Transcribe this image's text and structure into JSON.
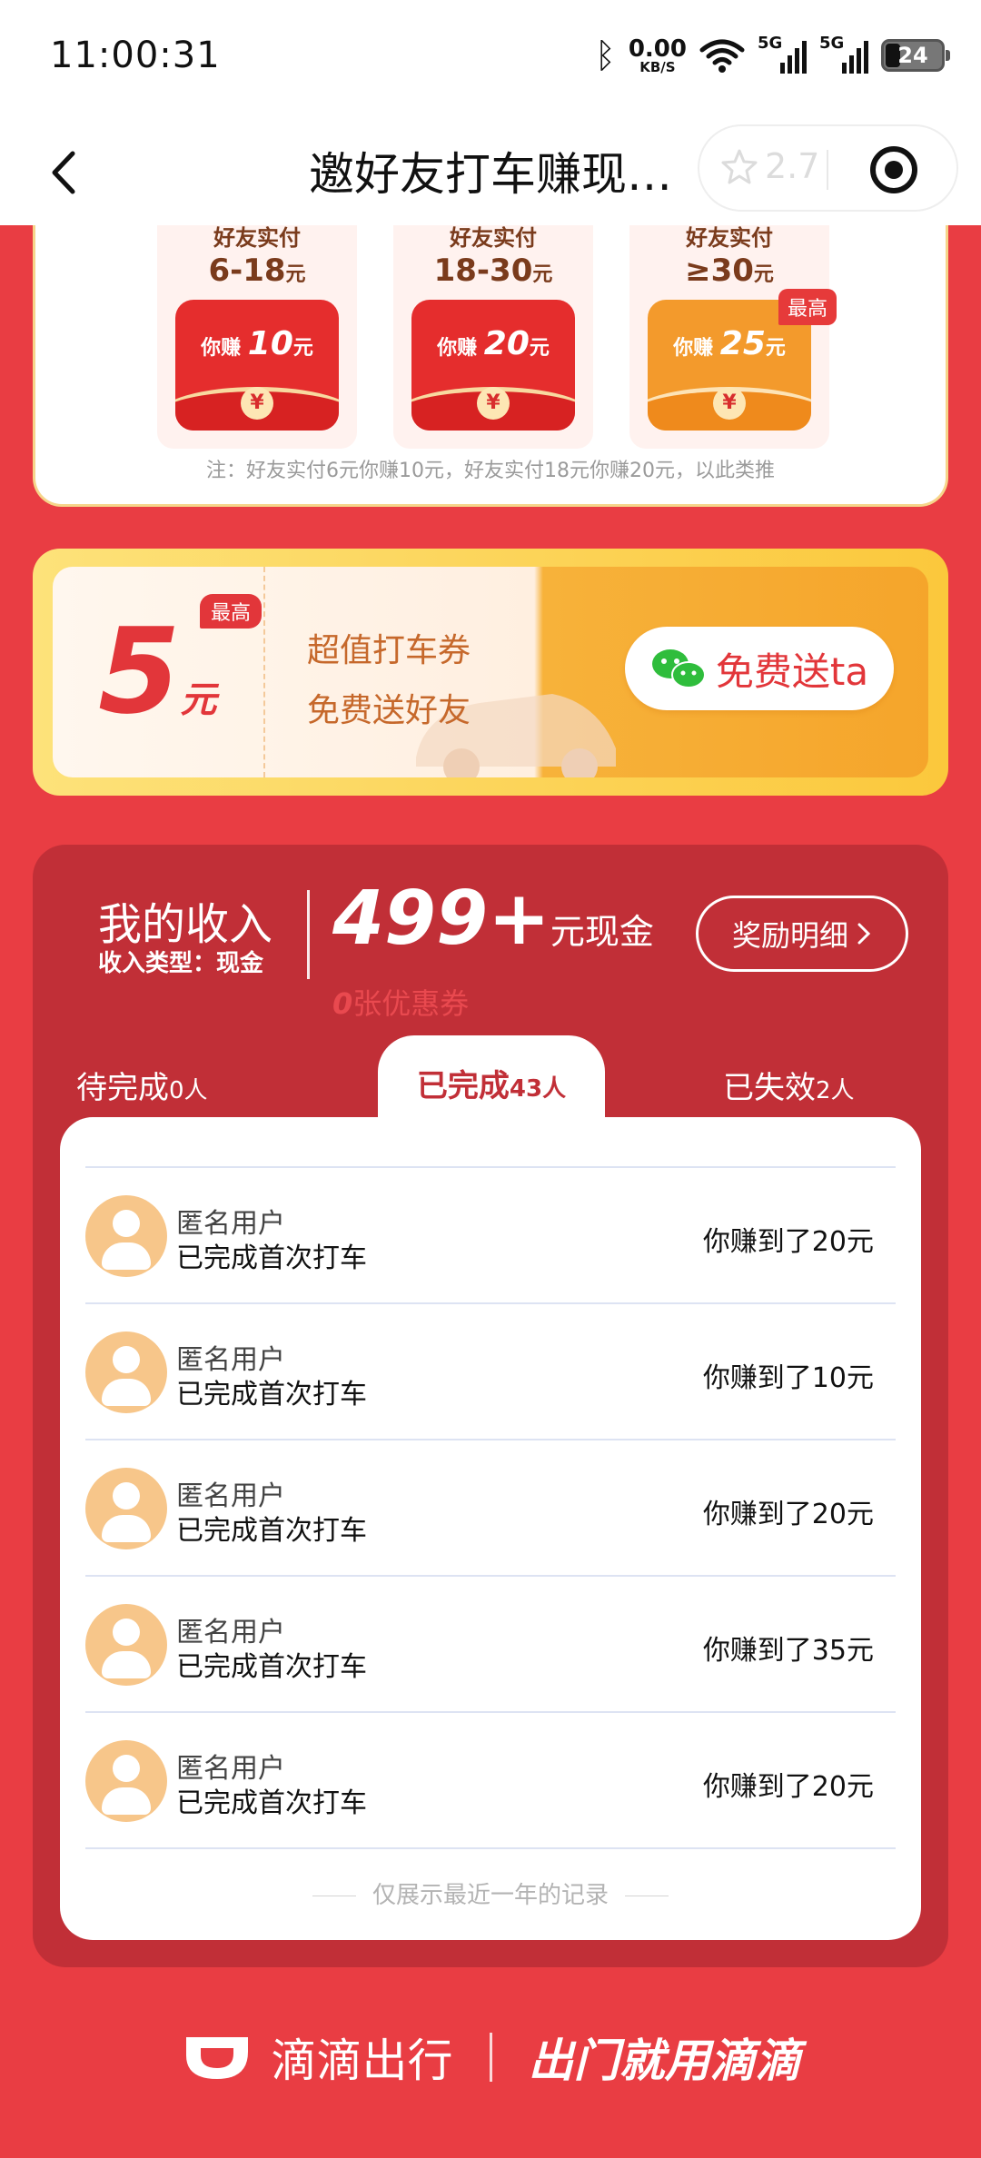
{
  "status_bar": {
    "time": "11:00:31",
    "net_speed": "0.00",
    "net_unit": "KB/S",
    "sig1": "5G",
    "sig2": "5G",
    "battery": "24"
  },
  "nav": {
    "title": "邀好友打车赚现…",
    "rating": "2.7"
  },
  "tiers": [
    {
      "head": "好友实付",
      "range": "6-18",
      "unit": "元",
      "env_prefix": "你赚",
      "env_amount": "10",
      "env_unit": "元"
    },
    {
      "head": "好友实付",
      "range": "18-30",
      "unit": "元",
      "env_prefix": "你赚",
      "env_amount": "20",
      "env_unit": "元"
    },
    {
      "head": "好友实付",
      "range": "≥30",
      "unit": "元",
      "env_prefix": "你赚",
      "env_amount": "25",
      "env_unit": "元",
      "badge": "最高"
    }
  ],
  "tier_note": "注：好友实付6元你赚10元，好友实付18元你赚20元，以此类推",
  "coupon": {
    "amount": "5",
    "unit": "元",
    "badge": "最高",
    "line1": "超值打车券",
    "line2": "免费送好友",
    "share_label": "免费送ta"
  },
  "income": {
    "title": "我的收入",
    "type_label": "收入类型：现金",
    "amount": "499+",
    "amount_unit": "元现金",
    "detail_label": "奖励明细",
    "coupon_count": "0",
    "coupon_label": "张优惠券"
  },
  "tabs": [
    {
      "label": "待完成",
      "count": "0人"
    },
    {
      "label": "已完成",
      "count": "43人"
    },
    {
      "label": "已失效",
      "count": "2人"
    }
  ],
  "records": [
    {
      "name": "匿名用户",
      "status": "已完成首次打车",
      "earn": "你赚到了20元"
    },
    {
      "name": "匿名用户",
      "status": "已完成首次打车",
      "earn": "你赚到了10元"
    },
    {
      "name": "匿名用户",
      "status": "已完成首次打车",
      "earn": "你赚到了20元"
    },
    {
      "name": "匿名用户",
      "status": "已完成首次打车",
      "earn": "你赚到了35元"
    },
    {
      "name": "匿名用户",
      "status": "已完成首次打车",
      "earn": "你赚到了20元"
    }
  ],
  "list_footer": "仅展示最近一年的记录",
  "brand": {
    "name": "滴滴出行",
    "slogan": "出门就用滴滴"
  },
  "colors": {
    "primary_red": "#e93d43",
    "panel_red": "#c12f37",
    "gold": "#fbc83c",
    "avatar": "#f7c68a"
  }
}
